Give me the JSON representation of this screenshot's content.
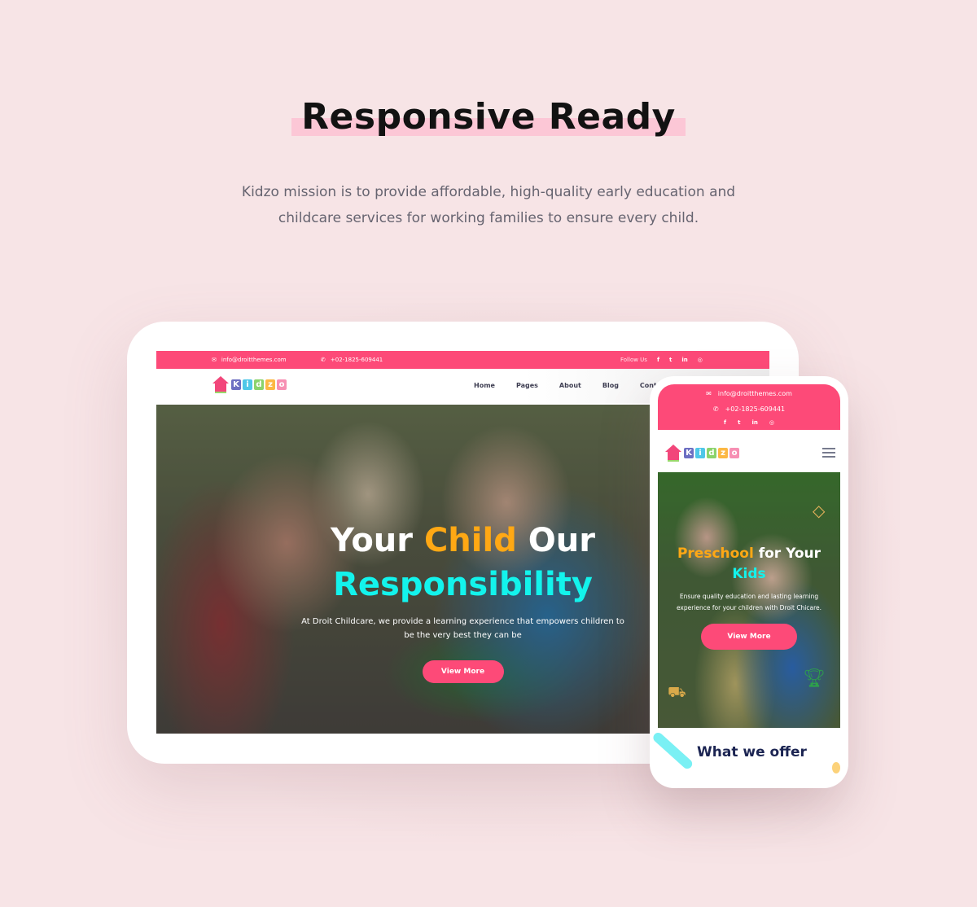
{
  "heading": "Responsive Ready",
  "subtitle": "Kidzo mission is to provide affordable, high-quality early education and childcare services for working families to ensure every child.",
  "colors": {
    "accent": "#fd4a78",
    "highlight": "#fcc7d6",
    "yellow": "#ffa814",
    "cyan": "#13f3ec",
    "navy": "#1b2452"
  },
  "logo": {
    "text": [
      "K",
      "i",
      "d",
      "z",
      "o"
    ]
  },
  "tablet": {
    "topbar": {
      "email": "info@droitthemes.com",
      "phone": "+02-1825-609441",
      "follow_label": "Follow Us",
      "social_icons": [
        "facebook-icon",
        "twitter-icon",
        "linkedin-icon",
        "dribbble-icon"
      ]
    },
    "menu": [
      "Home",
      "Pages",
      "About",
      "Blog",
      "Contact"
    ],
    "active_menu": "Home",
    "hero": {
      "title_part1": "Your ",
      "title_part2": "Child",
      "title_part3": " Our",
      "title_line2": "Responsibility",
      "description_line1": "At Droit Childcare, we provide a learning experience that empowers children to",
      "description_line2": "be the very best they can be",
      "button": "View More"
    }
  },
  "phone": {
    "topbar": {
      "email": "info@droitthemes.com",
      "phone": "+02-1825-609441",
      "social_icons": [
        "facebook-icon",
        "twitter-icon",
        "linkedin-icon",
        "dribbble-icon"
      ]
    },
    "hero": {
      "title_part1": "Preschool",
      "title_part2": " for Your",
      "title_line2": "Kids",
      "description_line1": "Ensure quality education and lasting learning",
      "description_line2": "experience for your children with Droit Chicare.",
      "button": "View More"
    },
    "section_title": "What we offer"
  },
  "glyphs": {
    "email": "✉",
    "phone": "✆",
    "facebook": "f",
    "twitter": "t",
    "linkedin": "in",
    "dribbble": "◎"
  }
}
